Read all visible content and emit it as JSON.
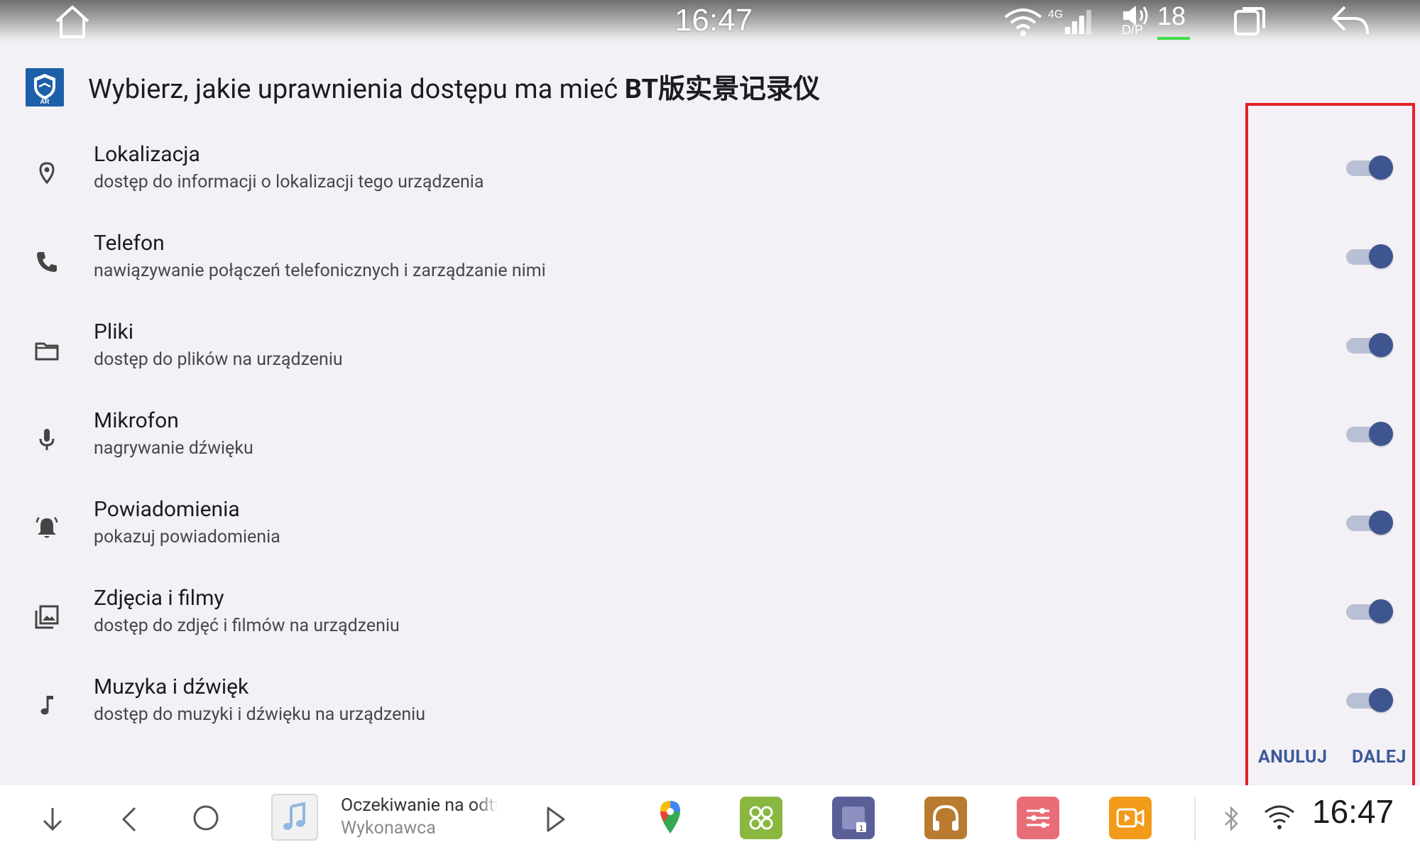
{
  "status_bar": {
    "time": "16:47",
    "network_type": "4G",
    "volume_level": "18",
    "volume_sub": "D/P",
    "icons": [
      "home-icon",
      "wifi-icon",
      "signal-icon",
      "volume-icon",
      "recent-apps-icon",
      "back-arrow-icon"
    ]
  },
  "dialog": {
    "title_prefix": "Wybierz, jakie uprawnienia dostępu ma mieć ",
    "app_name": "BT版实景记录仪",
    "app_icon_badge": "AR",
    "permissions": [
      {
        "title": "Lokalizacja",
        "description": "dostęp do informacji o lokalizacji tego urządzenia",
        "icon": "location-icon",
        "enabled": true
      },
      {
        "title": "Telefon",
        "description": "nawiązywanie połączeń telefonicznych i zarządzanie nimi",
        "icon": "phone-icon",
        "enabled": true
      },
      {
        "title": "Pliki",
        "description": "dostęp do plików na urządzeniu",
        "icon": "folder-icon",
        "enabled": true
      },
      {
        "title": "Mikrofon",
        "description": "nagrywanie dźwięku",
        "icon": "microphone-icon",
        "enabled": true
      },
      {
        "title": "Powiadomienia",
        "description": "pokazuj powiadomienia",
        "icon": "bell-icon",
        "enabled": true
      },
      {
        "title": "Zdjęcia i filmy",
        "description": "dostęp do zdjęć i filmów na urządzeniu",
        "icon": "photos-icon",
        "enabled": true
      },
      {
        "title": "Muzyka i dźwięk",
        "description": "dostęp do muzyki i dźwięku na urządzeniu",
        "icon": "music-note-icon",
        "enabled": true
      }
    ],
    "cancel_label": "ANULUJ",
    "next_label": "DALEJ"
  },
  "nav_bar": {
    "media_title": "Oczekiwanie na odtwarzanie",
    "media_artist": "Wykonawca",
    "clock": "16:47",
    "colors": {
      "maps": "#ffffff",
      "apps_green": "#8ab740",
      "split_purple": "#5b5f97",
      "headphones_brown": "#b87b2f",
      "equalizer_pink": "#e96d76",
      "video_orange": "#f29a1a"
    }
  },
  "colors": {
    "accent": "#3e5590",
    "button_text": "#3c5a9a",
    "highlight_border": "#e5202a",
    "background": "#f3f1f5"
  }
}
